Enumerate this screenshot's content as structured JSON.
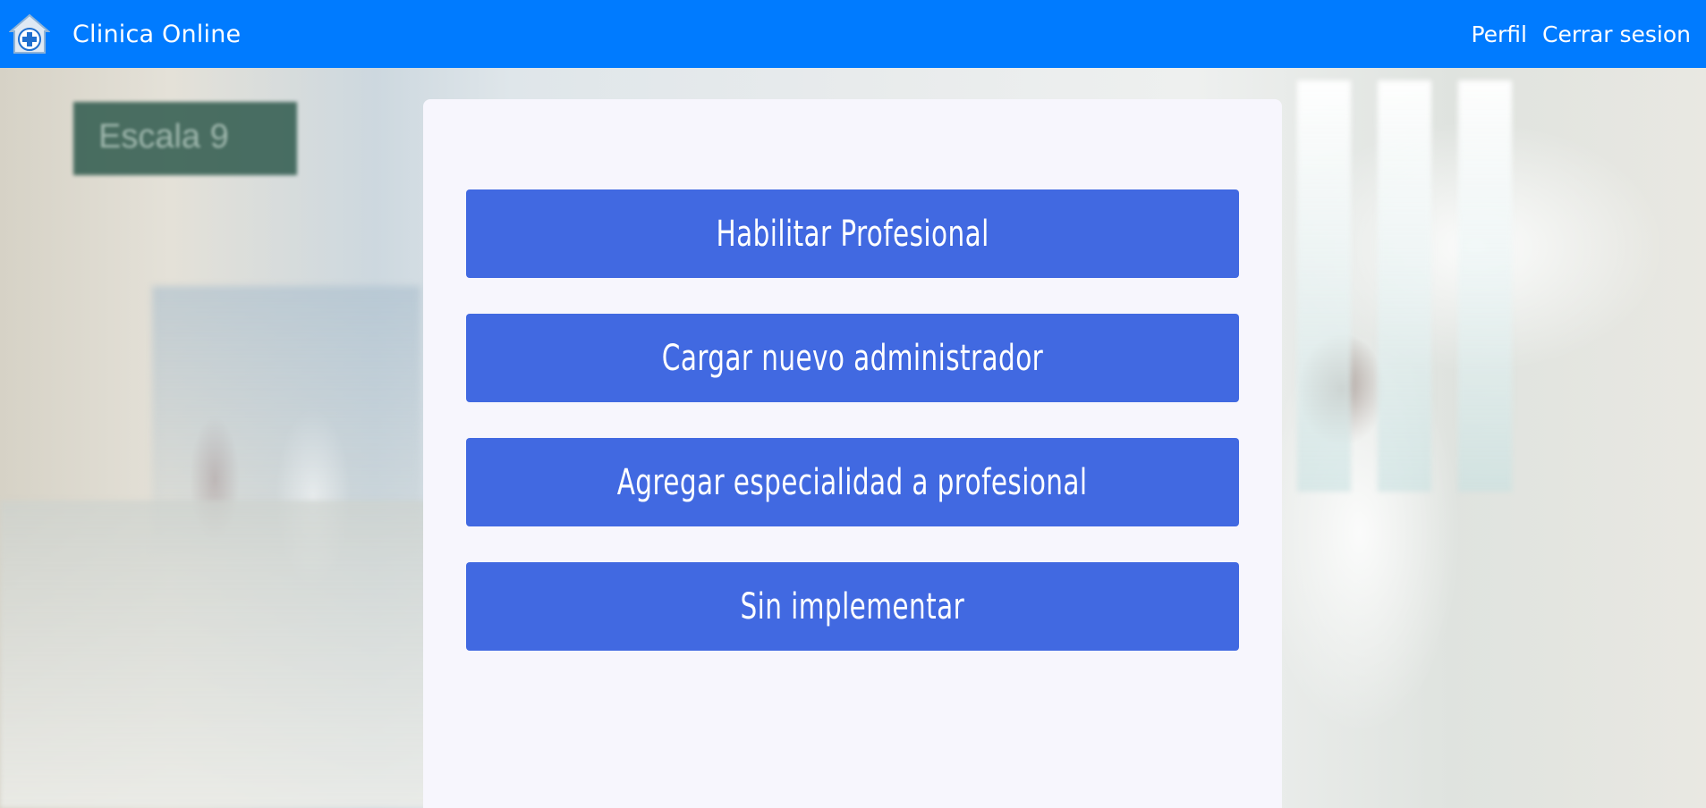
{
  "colors": {
    "navbar": "#007bff",
    "card": "#f7f6fd",
    "button": "#4169e1",
    "text_on_dark": "#ffffff"
  },
  "navbar": {
    "logo_icon": "hospital-house-cross-icon",
    "brand": "Clinica Online",
    "links": [
      {
        "label": "Perfil"
      },
      {
        "label": "Cerrar sesion"
      }
    ]
  },
  "background": {
    "sign_text": "Escala 9"
  },
  "main": {
    "actions": [
      {
        "label": "Habilitar Profesional"
      },
      {
        "label": "Cargar nuevo administrador"
      },
      {
        "label": "Agregar especialidad a profesional"
      },
      {
        "label": "Sin implementar"
      }
    ]
  }
}
